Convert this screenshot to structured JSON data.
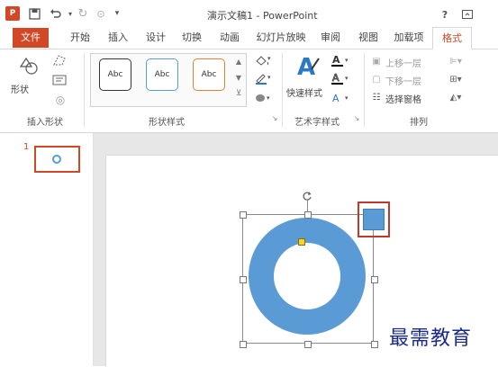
{
  "window": {
    "title": "演示文稿1 - PowerPoint",
    "help_label": "?",
    "app_logo_text": "P"
  },
  "tabs": [
    {
      "label": "文件"
    },
    {
      "label": "开始"
    },
    {
      "label": "插入"
    },
    {
      "label": "设计"
    },
    {
      "label": "切换"
    },
    {
      "label": "动画"
    },
    {
      "label": "幻灯片放映"
    },
    {
      "label": "审阅"
    },
    {
      "label": "视图"
    },
    {
      "label": "加载项"
    },
    {
      "label": "格式"
    }
  ],
  "ribbon": {
    "insert_shapes": {
      "shapes_label": "形状",
      "group_label": "插入形状"
    },
    "shape_styles": {
      "samples": [
        "Abc",
        "Abc",
        "Abc"
      ],
      "group_label": "形状样式"
    },
    "wordart": {
      "quick_styles_label": "快速样式",
      "group_label": "艺术字样式"
    },
    "arrange": {
      "bring_forward": "上移一层",
      "send_backward": "下移一层",
      "selection_pane": "选择窗格",
      "group_label": "排列"
    }
  },
  "slides_panel": {
    "slide_number": "1"
  },
  "watermark": "最需教育",
  "colors": {
    "accent": "#d24726",
    "shape_fill": "#5b9bd5",
    "highlight_box": "#c0392b"
  }
}
